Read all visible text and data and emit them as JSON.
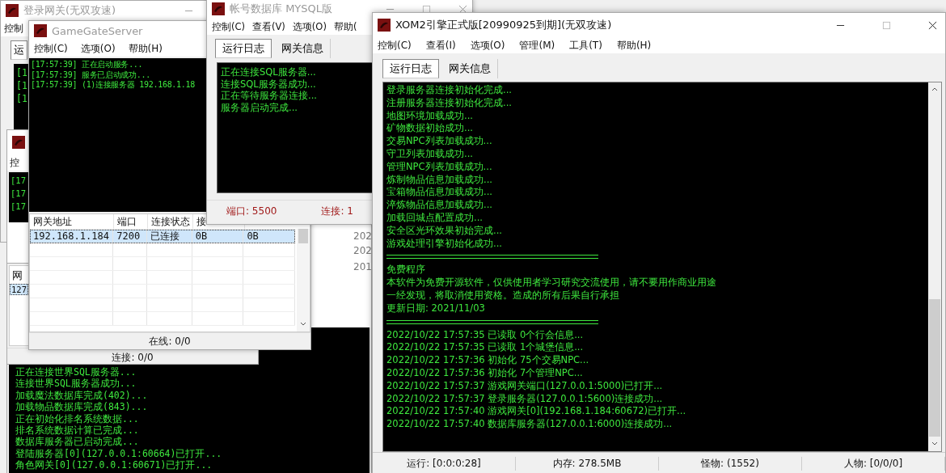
{
  "login_gateway_window": {
    "title": "登录网关(无双攻速)",
    "menu": [
      "控制"
    ],
    "tabs": [
      {
        "label": "运",
        "selected": true
      }
    ],
    "log": [
      "[1",
      "[1",
      "[1"
    ]
  },
  "left_log_window": {
    "menu": [
      "控"
    ],
    "top_log": [
      "[17",
      "[17",
      "[17"
    ],
    "list_fragment": [
      "202",
      "202",
      "201"
    ],
    "log": [
      "正在连接世界SQL服务器...",
      "连接世界SQL服务器成功...",
      "加载魔法数据库完成(402)...",
      "加载物品数据库完成(843)...",
      "正在初始化排名系统数据...",
      "排名系统数据计算已完成...",
      "数据库服务器已启动完成...",
      "登陆服务器[0](127.0.0.1:60664)已打开...",
      "角色网关[0](127.0.0.1:60671)已打开..."
    ]
  },
  "gateway_list_window": {
    "column_1": "网",
    "rows": [
      {
        "cell": "127",
        "selected": true
      }
    ],
    "status": "连接: 0/0"
  },
  "game_gate_window": {
    "title": "GameGateServer",
    "menu": [
      "控制(C)",
      "选项(O)",
      "帮助(H)"
    ],
    "log": [
      "[17:57:39] 正在启动服务...",
      "[17:57:39] 服务已启动成功...",
      "[17:57:39] (1)连接服务器 192.168.1.18"
    ],
    "columns": [
      "网关地址",
      "端口",
      "连接状态",
      "接"
    ],
    "rows": [
      {
        "cells": [
          "192.168.1.184",
          "7200",
          "已连接",
          "0B",
          "0B"
        ],
        "selected": true
      }
    ],
    "status": "在线: 0/0"
  },
  "account_db_window": {
    "title": "帐号数据库 MYSQL版",
    "menu": [
      "控制(C)",
      "查看(V)",
      "选项(O)",
      "帮助("
    ],
    "tabs": [
      {
        "label": "运行日志",
        "selected": true
      },
      {
        "label": "网关信息",
        "selected": false
      }
    ],
    "log": [
      "正在连接SQL服务器...",
      "连接SQL服务器成功...",
      "正在等待服务器连接...",
      "服务器启动完成..."
    ],
    "status": [
      "端口: 5500",
      "连接: 1"
    ]
  },
  "engine_window": {
    "title": "XOM2引擎正式版[20990925到期](无双攻速)",
    "menu": [
      "控制(C)",
      "查看(I)",
      "选项(O)",
      "管理(M)",
      "工具(T)",
      "帮助(H)"
    ],
    "tabs": [
      {
        "label": "运行日志",
        "selected": true
      },
      {
        "label": "网关信息",
        "selected": false
      }
    ],
    "log": [
      {
        "kind": "text",
        "text": "登录服务器连接初始化完成..."
      },
      {
        "kind": "text",
        "text": "注册服务器连接初始化完成..."
      },
      {
        "kind": "text",
        "text": "地图环境加载成功..."
      },
      {
        "kind": "text",
        "text": "矿物数据初始成功..."
      },
      {
        "kind": "text",
        "text": "交易NPC列表加载成功..."
      },
      {
        "kind": "text",
        "text": "守卫列表加载成功..."
      },
      {
        "kind": "text",
        "text": "管理NPC列表加载成功..."
      },
      {
        "kind": "text",
        "text": "炼制物品信息加载成功..."
      },
      {
        "kind": "text",
        "text": "宝箱物品信息加载成功..."
      },
      {
        "kind": "text",
        "text": "淬炼物品信息加载成功..."
      },
      {
        "kind": "text",
        "text": "加载回城点配置成功..."
      },
      {
        "kind": "text",
        "text": "安全区光环效果初始完成..."
      },
      {
        "kind": "text",
        "text": "游戏处理引擎初始化成功..."
      },
      {
        "kind": "rule"
      },
      {
        "kind": "text",
        "text": "免费程序"
      },
      {
        "kind": "text",
        "text": "本软件为免费开源软件，仅供使用者学习研究交流使用，请不要用作商业用途"
      },
      {
        "kind": "text",
        "text": "一经发现，将取消使用资格。造成的所有后果自行承担"
      },
      {
        "kind": "text",
        "text": "更新日期: 2021/11/03"
      },
      {
        "kind": "rule"
      },
      {
        "kind": "text",
        "text": "2022/10/22 17:57:35 已读取 0个行会信息..."
      },
      {
        "kind": "text",
        "text": "2022/10/22 17:57:35 已读取 1个城堡信息..."
      },
      {
        "kind": "text",
        "text": "2022/10/22 17:57:36 初始化 75个交易NPC..."
      },
      {
        "kind": "text",
        "text": "2022/10/22 17:57:36 初始化 7个管理NPC..."
      },
      {
        "kind": "text",
        "text": "2022/10/22 17:57:37 游戏网关端口(127.0.0.1:5000)已打开..."
      },
      {
        "kind": "text",
        "text": "2022/10/22 17:57:37 登录服务器(127.0.0.1:5600)连接成功..."
      },
      {
        "kind": "text",
        "text": "2022/10/22 17:57:40 游戏网关[0](192.168.1.184:60672)已打开..."
      },
      {
        "kind": "text",
        "text": "2022/10/22 17:57:40 数据库服务器(127.0.0.1:6000)连接成功..."
      }
    ],
    "status": [
      "运行: [0:0:0:28]",
      "内存: 278.5MB",
      "怪物: (1552)",
      "人物: [0/0/0]"
    ]
  }
}
